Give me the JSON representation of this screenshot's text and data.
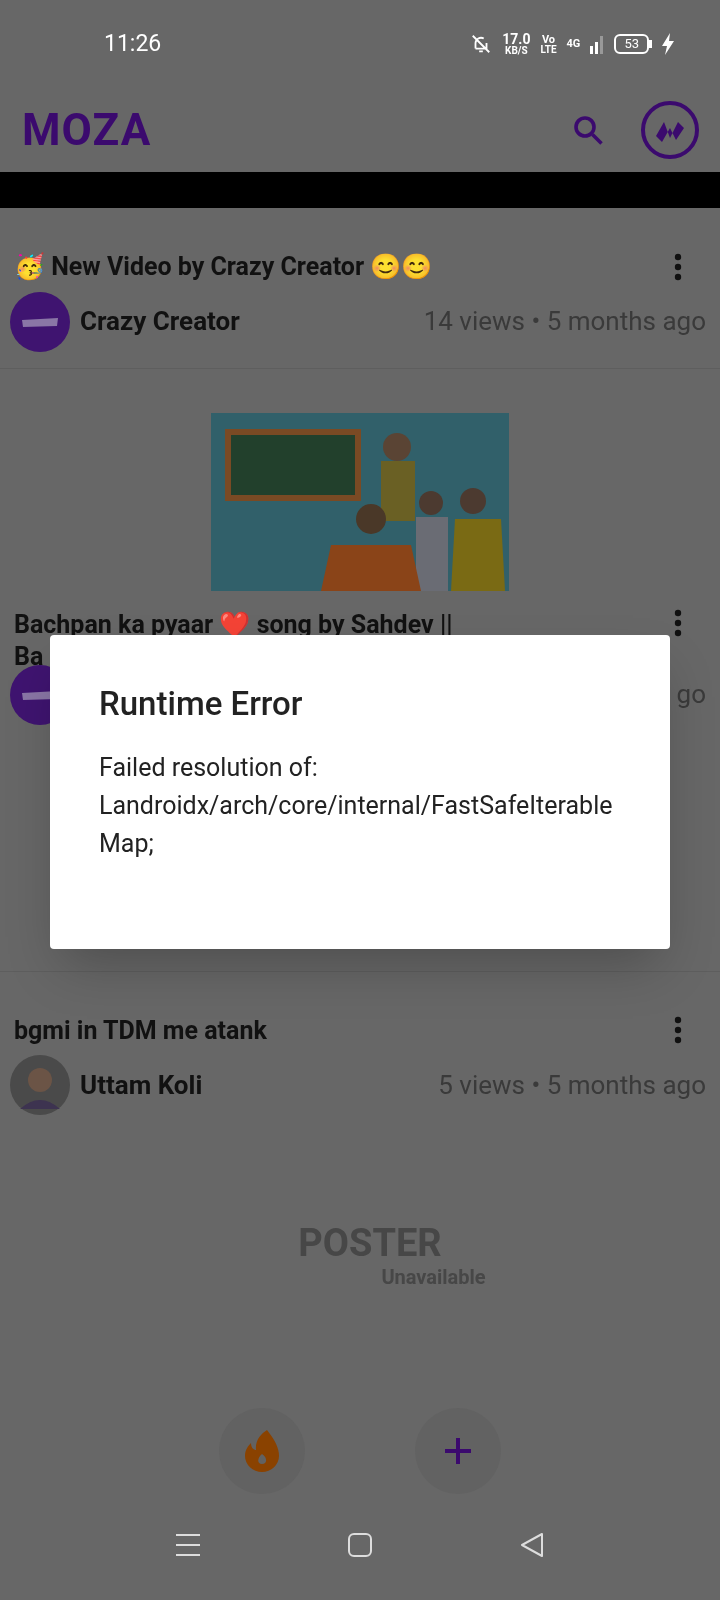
{
  "status_bar": {
    "time": "11:26",
    "speed": "17.0",
    "speed_unit": "KB/S",
    "volte_top": "Vo",
    "volte_bottom": "LTE",
    "network": "4G",
    "battery": "53"
  },
  "app_bar": {
    "title": "MOZA"
  },
  "posts": [
    {
      "kind": "full",
      "title": "🥳 New Video by Crazy Creator 😊😊",
      "author": "Crazy Creator",
      "meta": "14 views • 5 months ago"
    },
    {
      "kind": "covered",
      "title_lines": [
        "Bachpan ka pyaar ❤️ song by Sahdev ||",
        "Ba"
      ],
      "meta": "go",
      "thumbnail": {
        "kind": "picture"
      }
    },
    {
      "kind": "full",
      "title": "bgmi in TDM me atank",
      "author": "Uttam Koli",
      "meta": "5 views • 5 months ago",
      "poster": [
        "POSTER",
        "Unavailable"
      ]
    }
  ],
  "dialog": {
    "title": "Runtime Error",
    "message": "Failed resolution of: Landroidx/arch/core/internal/FastSafeIterableMap;"
  }
}
